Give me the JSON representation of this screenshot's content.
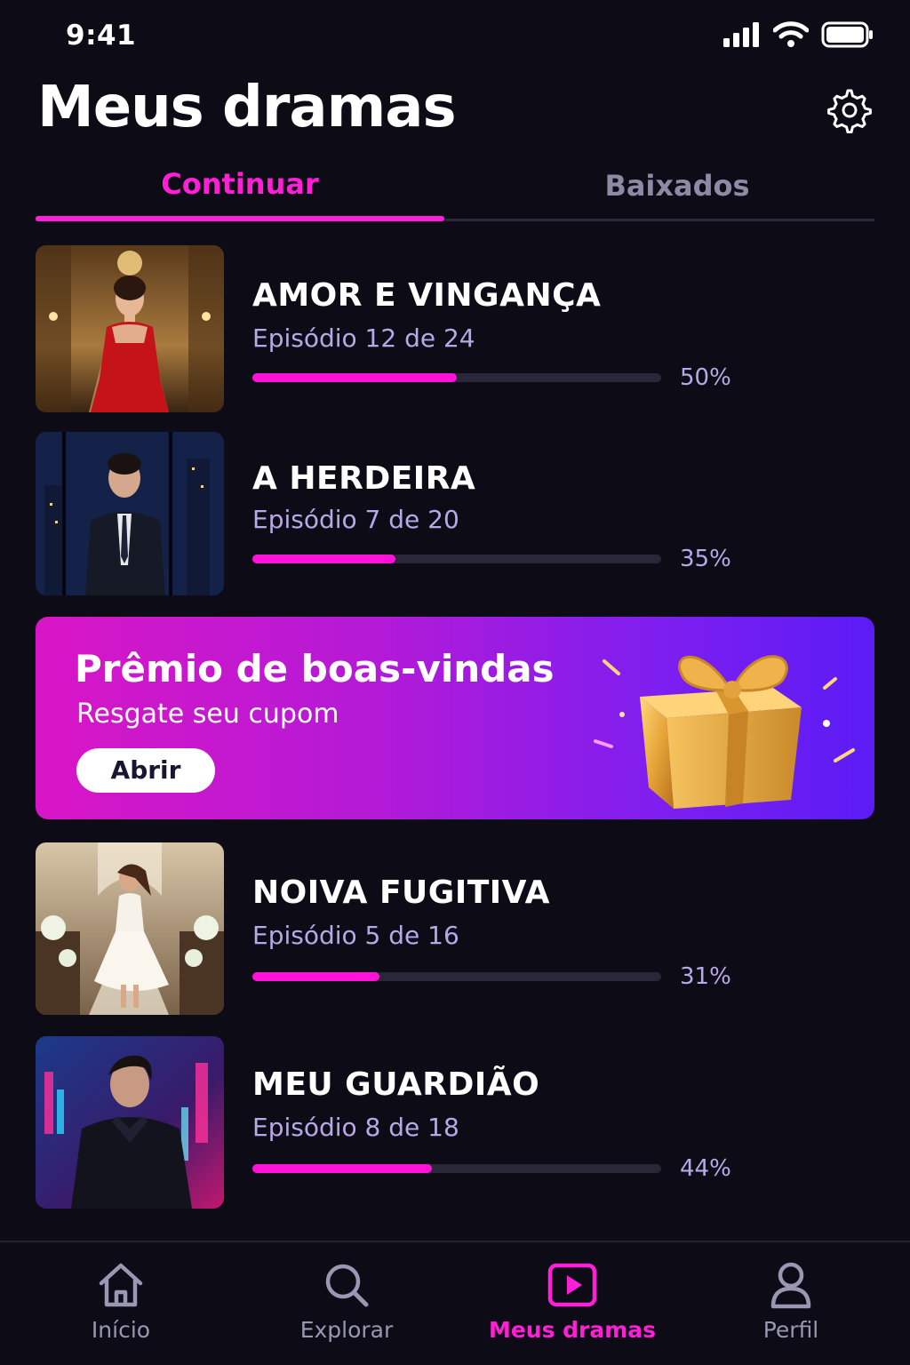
{
  "status": {
    "time": "9:41"
  },
  "header": {
    "title": "Meus dramas"
  },
  "tabs": [
    {
      "label": "Continuar",
      "active": true
    },
    {
      "label": "Baixados",
      "active": false
    }
  ],
  "dramas": [
    {
      "title": "AMOR E VINGANÇA",
      "episode": "Episódio 12 de 24",
      "progress_label": "50%",
      "progress": 0.5
    },
    {
      "title": "A HERDEIRA",
      "episode": "Episódio 7 de 20",
      "progress_label": "35%",
      "progress": 0.35
    },
    {
      "title": "NOIVA FUGITIVA",
      "episode": "Episódio 5 de 16",
      "progress_label": "31%",
      "progress": 0.31
    },
    {
      "title": "MEU GUARDIÃO",
      "episode": "Episódio 8 de 18",
      "progress_label": "44%",
      "progress": 0.44
    }
  ],
  "promo": {
    "title": "Prêmio de boas-vindas",
    "subtitle": "Resgate seu cupom",
    "button": "Abrir"
  },
  "nav": [
    {
      "label": "Início",
      "icon": "home-icon"
    },
    {
      "label": "Explorar",
      "icon": "search-icon"
    },
    {
      "label": "Meus dramas",
      "icon": "play-icon",
      "active": true
    },
    {
      "label": "Perfil",
      "icon": "profile-icon"
    }
  ],
  "colors": {
    "accent": "#ff1fd6",
    "background": "#0c0b16",
    "secondary_text": "#b6a9e8"
  }
}
